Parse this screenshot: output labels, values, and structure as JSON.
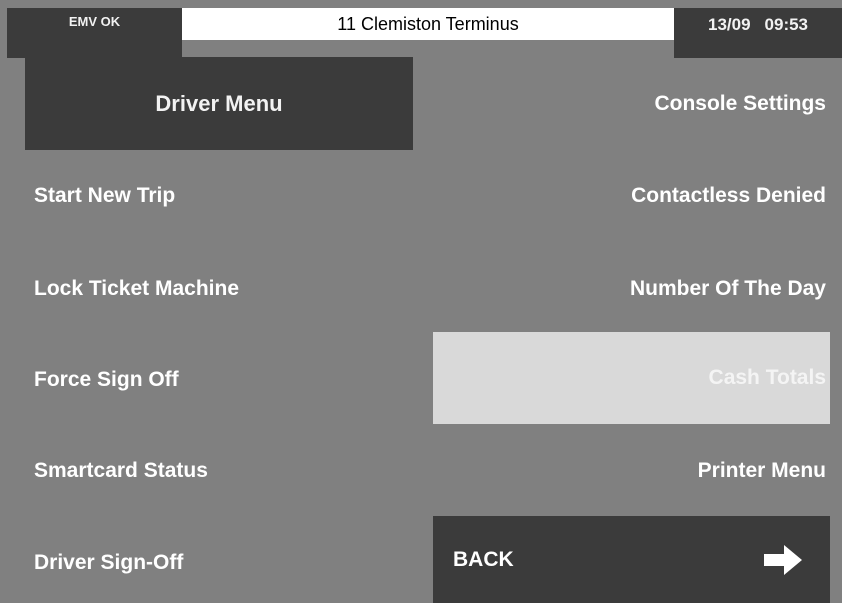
{
  "colors": {
    "background": "#808080",
    "dark_panel": "#3b3b3b",
    "highlight_panel": "#d9d9d9",
    "text_light": "#ffffff",
    "route_bg": "#ffffff"
  },
  "status_bar": {
    "emv_status": "EMV OK",
    "route": "11 Clemiston Terminus",
    "date": "13/09",
    "time": "09:53"
  },
  "header": {
    "title": "Driver Menu"
  },
  "menu": {
    "left": [
      "Start New Trip",
      "Lock Ticket Machine",
      "Force Sign Off",
      "Smartcard Status",
      "Driver Sign-Off"
    ],
    "right": [
      "Console Settings",
      "Contactless Denied",
      "Number Of The Day",
      "Cash Totals",
      "Printer Menu"
    ]
  },
  "back_button": {
    "label": "BACK",
    "icon": "right-arrow-icon"
  }
}
